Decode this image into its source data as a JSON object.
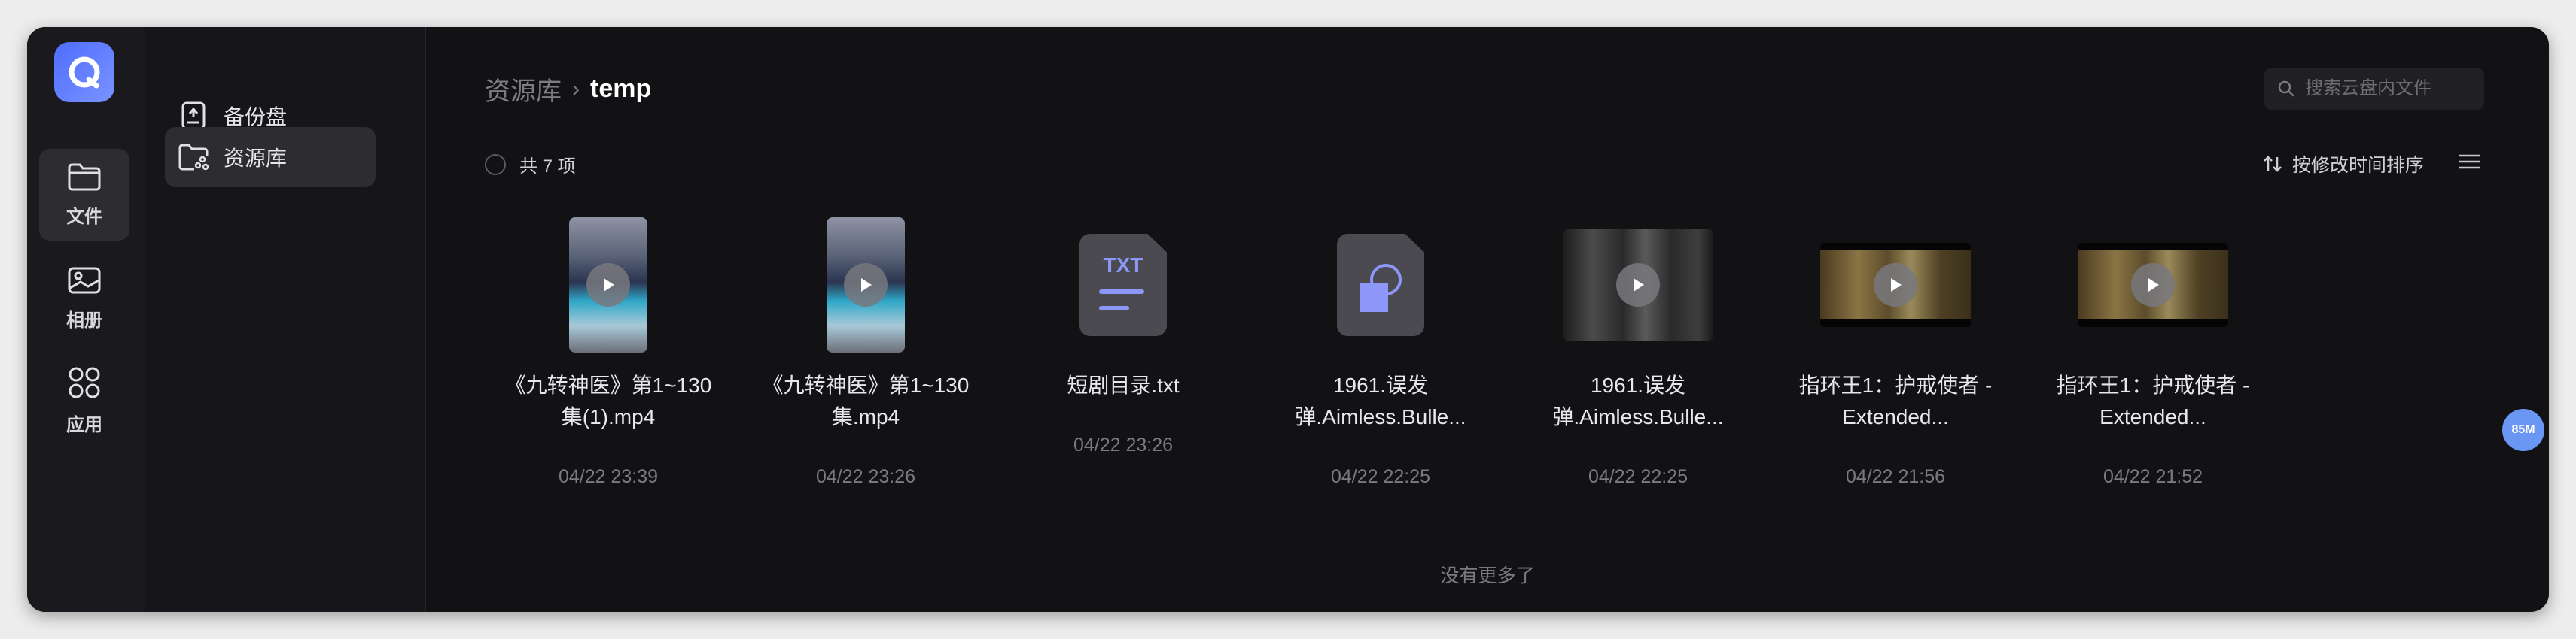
{
  "rail": {
    "items": [
      {
        "label": "文件",
        "icon": "folder-icon",
        "active": true
      },
      {
        "label": "相册",
        "icon": "photo-icon",
        "active": false
      },
      {
        "label": "应用",
        "icon": "apps-icon",
        "active": false
      }
    ]
  },
  "sidebar": {
    "items": [
      {
        "label": "备份盘",
        "icon": "backup-drive-icon",
        "active": false
      },
      {
        "label": "资源库",
        "icon": "shared-folder-icon",
        "active": true
      }
    ]
  },
  "breadcrumb": {
    "parent": "资源库",
    "separator": "›",
    "current": "temp"
  },
  "search": {
    "placeholder": "搜索云盘内文件"
  },
  "toolbar": {
    "select_all_label": "共 7 项",
    "sort_label": "按修改时间排序"
  },
  "files": [
    {
      "name": "《九转神医》第1~130集(1).mp4",
      "date": "04/22 23:39",
      "type": "video-portrait"
    },
    {
      "name": "《九转神医》第1~130集.mp4",
      "date": "04/22 23:26",
      "type": "video-portrait"
    },
    {
      "name": "短剧目录.txt",
      "date": "04/22 23:26",
      "type": "txt",
      "badge": "TXT"
    },
    {
      "name": "1961.误发弹.Aimless.Bulle...",
      "date": "04/22 22:25",
      "type": "archive"
    },
    {
      "name": "1961.误发弹.Aimless.Bulle...",
      "date": "04/22 22:25",
      "type": "video-dark"
    },
    {
      "name": "指环王1：护戒使者 - Extended...",
      "date": "04/22 21:56",
      "type": "video-wide"
    },
    {
      "name": "指环王1：护戒使者 - Extended...",
      "date": "04/22 21:52",
      "type": "video-wide"
    }
  ],
  "footer": {
    "end_text": "没有更多了"
  },
  "storage_badge": "85M",
  "colors": {
    "accent": "#4f6dff",
    "background": "#121215",
    "badge": "#6a97f4"
  }
}
